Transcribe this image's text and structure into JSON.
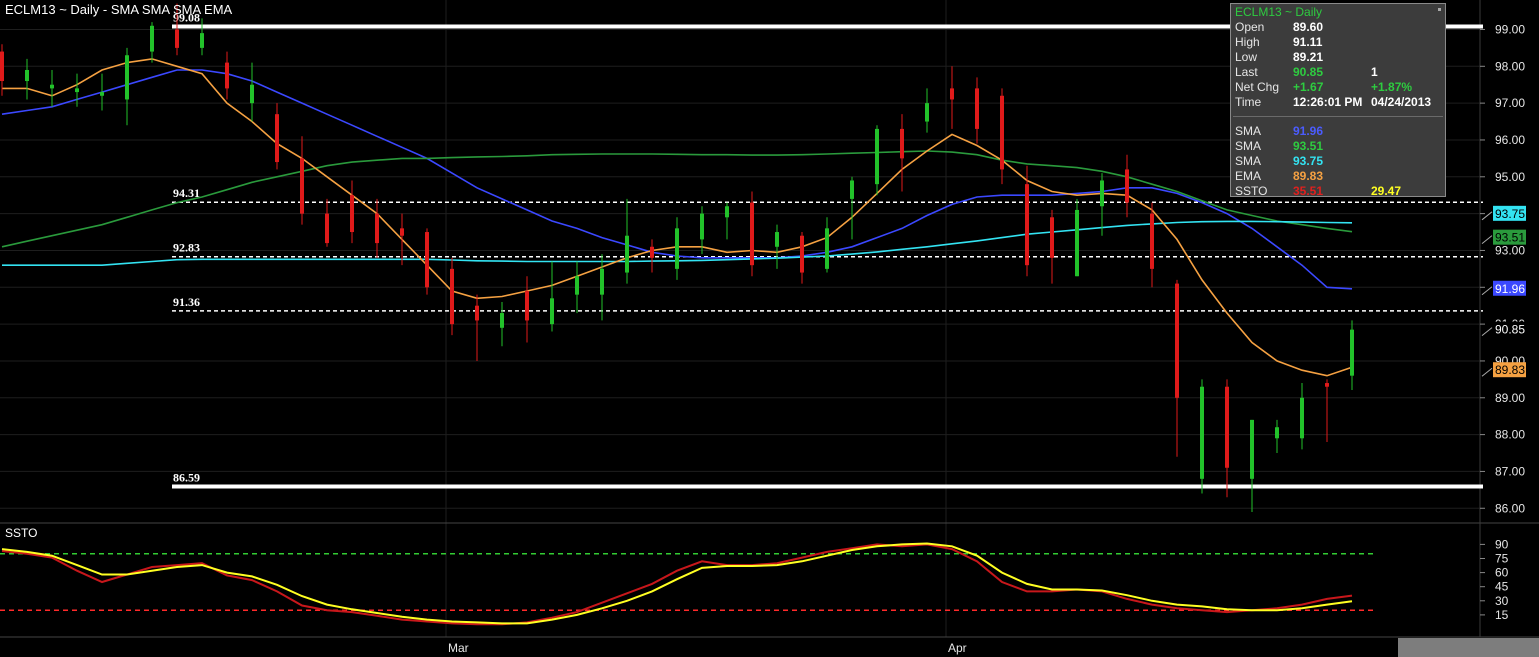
{
  "header": {
    "title": "ECLM13 ~ Daily  -  SMA SMA SMA EMA"
  },
  "chart_data": {
    "type": "candlestick",
    "symbol": "ECLM13 ~ Daily",
    "y_price_range": [
      85.6,
      99.8
    ],
    "price_ticks": [
      "99.00",
      "98.00",
      "97.00",
      "96.00",
      "95.00",
      "94.00",
      "93.00",
      "92.00",
      "91.00",
      "90.00",
      "89.00",
      "88.00",
      "87.00",
      "86.00"
    ],
    "month_labels": [
      {
        "label": "Mar",
        "index": 18
      },
      {
        "label": "Apr",
        "index": 38
      }
    ],
    "candles": [
      [
        98.4,
        98.6,
        97.2,
        97.6
      ],
      [
        97.6,
        98.2,
        97.1,
        97.9
      ],
      [
        97.4,
        97.9,
        96.9,
        97.5
      ],
      [
        97.3,
        97.8,
        96.9,
        97.4
      ],
      [
        97.2,
        97.8,
        96.8,
        97.3
      ],
      [
        97.1,
        98.5,
        96.4,
        98.3
      ],
      [
        98.4,
        99.2,
        98.1,
        99.1
      ],
      [
        99.0,
        99.7,
        98.3,
        98.5
      ],
      [
        98.5,
        99.3,
        98.3,
        98.9
      ],
      [
        98.1,
        98.4,
        97.1,
        97.4
      ],
      [
        97.0,
        98.1,
        96.5,
        97.5
      ],
      [
        96.7,
        97.0,
        95.2,
        95.4
      ],
      [
        95.5,
        96.1,
        93.7,
        94.0
      ],
      [
        94.0,
        94.4,
        93.1,
        93.2
      ],
      [
        94.5,
        94.9,
        93.2,
        93.5
      ],
      [
        94.0,
        94.4,
        92.8,
        93.2
      ],
      [
        93.6,
        94.0,
        92.6,
        93.4
      ],
      [
        93.5,
        93.6,
        91.8,
        92.0
      ],
      [
        92.5,
        92.8,
        90.7,
        91.0
      ],
      [
        91.5,
        91.8,
        90.0,
        91.1
      ],
      [
        90.9,
        91.6,
        90.4,
        91.3
      ],
      [
        91.9,
        92.3,
        90.5,
        91.1
      ],
      [
        91.0,
        92.7,
        90.8,
        91.7
      ],
      [
        91.8,
        92.7,
        91.3,
        92.3
      ],
      [
        91.8,
        92.9,
        91.1,
        92.5
      ],
      [
        92.4,
        94.4,
        92.1,
        93.4
      ],
      [
        93.1,
        93.3,
        92.4,
        92.8
      ],
      [
        92.5,
        93.9,
        92.2,
        93.6
      ],
      [
        93.3,
        94.2,
        92.9,
        94.0
      ],
      [
        93.9,
        94.3,
        93.3,
        94.2
      ],
      [
        94.3,
        94.6,
        92.3,
        92.6
      ],
      [
        93.1,
        93.7,
        92.5,
        93.5
      ],
      [
        93.4,
        93.5,
        92.1,
        92.4
      ],
      [
        92.5,
        93.9,
        92.4,
        93.6
      ],
      [
        94.4,
        95.0,
        93.3,
        94.9
      ],
      [
        94.8,
        96.4,
        94.5,
        96.3
      ],
      [
        96.3,
        96.7,
        94.6,
        95.5
      ],
      [
        96.5,
        97.4,
        96.2,
        97.0
      ],
      [
        97.4,
        98.0,
        96.3,
        97.1
      ],
      [
        97.4,
        97.7,
        95.9,
        96.3
      ],
      [
        97.2,
        97.4,
        94.8,
        95.2
      ],
      [
        94.8,
        95.3,
        92.3,
        92.6
      ],
      [
        93.9,
        94.1,
        92.1,
        92.8
      ],
      [
        92.3,
        94.4,
        92.3,
        94.1
      ],
      [
        94.2,
        95.1,
        93.4,
        94.9
      ],
      [
        95.2,
        95.6,
        93.9,
        94.3
      ],
      [
        94.0,
        94.3,
        92.0,
        92.5
      ],
      [
        92.1,
        92.2,
        87.4,
        89.0
      ],
      [
        86.8,
        89.5,
        86.4,
        89.3
      ],
      [
        89.3,
        89.5,
        86.3,
        87.1
      ],
      [
        86.8,
        88.4,
        85.9,
        88.4
      ],
      [
        87.9,
        88.4,
        87.5,
        88.2
      ],
      [
        87.9,
        89.4,
        87.6,
        89.0
      ],
      [
        89.4,
        89.5,
        87.8,
        89.3
      ],
      [
        89.6,
        91.1,
        89.21,
        90.85
      ]
    ],
    "series": [
      {
        "name": "SMA",
        "color": "#3b48ff",
        "values": [
          96.7,
          96.8,
          96.9,
          97.1,
          97.3,
          97.5,
          97.7,
          97.9,
          97.9,
          97.8,
          97.6,
          97.3,
          97.0,
          96.7,
          96.4,
          96.1,
          95.8,
          95.5,
          95.1,
          94.7,
          94.4,
          94.1,
          93.8,
          93.6,
          93.35,
          93.15,
          92.95,
          92.85,
          92.8,
          92.8,
          92.8,
          92.8,
          92.85,
          92.95,
          93.1,
          93.35,
          93.6,
          93.95,
          94.25,
          94.45,
          94.5,
          94.5,
          94.5,
          94.55,
          94.6,
          94.7,
          94.7,
          94.55,
          94.3,
          94.0,
          93.6,
          93.1,
          92.6,
          92.0,
          91.96
        ]
      },
      {
        "name": "SMA",
        "color": "#2a9a3c",
        "values": [
          93.1,
          93.25,
          93.4,
          93.55,
          93.7,
          93.9,
          94.1,
          94.3,
          94.45,
          94.65,
          94.85,
          95.0,
          95.15,
          95.3,
          95.4,
          95.45,
          95.5,
          95.5,
          95.52,
          95.54,
          95.55,
          95.57,
          95.6,
          95.61,
          95.62,
          95.62,
          95.62,
          95.61,
          95.6,
          95.6,
          95.59,
          95.59,
          95.6,
          95.62,
          95.64,
          95.66,
          95.68,
          95.7,
          95.67,
          95.6,
          95.45,
          95.35,
          95.3,
          95.25,
          95.15,
          95.0,
          94.8,
          94.6,
          94.35,
          94.1,
          93.95,
          93.8,
          93.7,
          93.6,
          93.51
        ]
      },
      {
        "name": "SMA",
        "color": "#33e3f2",
        "values": [
          92.6,
          92.6,
          92.6,
          92.6,
          92.6,
          92.65,
          92.7,
          92.75,
          92.76,
          92.76,
          92.76,
          92.76,
          92.76,
          92.76,
          92.76,
          92.76,
          92.76,
          92.76,
          92.74,
          92.72,
          92.71,
          92.7,
          92.7,
          92.7,
          92.7,
          92.7,
          92.71,
          92.72,
          92.73,
          92.75,
          92.77,
          92.79,
          92.82,
          92.85,
          92.9,
          92.96,
          93.03,
          93.1,
          93.18,
          93.26,
          93.35,
          93.44,
          93.5,
          93.56,
          93.62,
          93.68,
          93.72,
          93.76,
          93.78,
          93.79,
          93.79,
          93.78,
          93.77,
          93.76,
          93.75
        ]
      },
      {
        "name": "EMA",
        "color": "#f5a142",
        "values": [
          97.4,
          97.4,
          97.2,
          97.5,
          97.9,
          98.1,
          98.2,
          98.0,
          97.8,
          97.0,
          96.5,
          95.9,
          95.5,
          95.0,
          94.5,
          94.0,
          93.3,
          92.6,
          91.9,
          91.7,
          91.75,
          91.9,
          92.05,
          92.3,
          92.55,
          92.8,
          93.0,
          93.1,
          93.1,
          92.95,
          93.0,
          92.95,
          93.1,
          93.35,
          93.9,
          94.55,
          95.2,
          95.7,
          96.15,
          95.85,
          95.45,
          94.9,
          94.6,
          94.5,
          94.55,
          94.5,
          94.1,
          93.3,
          92.2,
          91.3,
          90.5,
          90.0,
          89.75,
          89.6,
          89.83
        ]
      }
    ],
    "horizontal_lines": [
      {
        "value": 99.08,
        "label": "99.08",
        "style": "solid"
      },
      {
        "value": 94.31,
        "label": "94.31",
        "style": "dashed"
      },
      {
        "value": 92.83,
        "label": "92.83",
        "style": "dashed"
      },
      {
        "value": 91.36,
        "label": "91.36",
        "style": "dashed"
      },
      {
        "value": 86.59,
        "label": "86.59",
        "style": "solid"
      }
    ],
    "right_markers": [
      {
        "value": 93.75,
        "label": "93.75",
        "bg": "#33e3f2",
        "fg": "#000000"
      },
      {
        "value": 93.51,
        "label": "93.51",
        "bg": "#2a9a3c",
        "fg": "#000000"
      },
      {
        "value": 91.96,
        "label": "91.96",
        "bg": "#3b48ff",
        "fg": "#ffffff"
      },
      {
        "value": 90.85,
        "label": "90.85",
        "bg": "#000000",
        "fg": "#ffffff"
      },
      {
        "value": 89.83,
        "label": "89.83",
        "bg": "#f5a142",
        "fg": "#000000"
      }
    ],
    "ssto": {
      "label": "SSTO",
      "ylim": [
        0,
        100
      ],
      "ticks": [
        "90",
        "75",
        "60",
        "45",
        "30",
        "15"
      ],
      "levels": [
        {
          "value": 80,
          "color": "#33cc33"
        },
        {
          "value": 20,
          "color": "#ff2a2a"
        }
      ],
      "series": [
        {
          "name": "SSTO",
          "color": "#c8171b",
          "values": [
            83,
            80,
            76,
            62,
            50,
            58,
            66,
            68,
            70,
            57,
            52,
            40,
            25,
            20,
            18,
            14,
            10,
            8,
            6,
            5,
            5,
            7,
            12,
            18,
            28,
            38,
            48,
            62,
            72,
            68,
            68,
            70,
            76,
            82,
            86,
            90,
            88,
            90,
            85,
            72,
            50,
            40,
            40,
            42,
            40,
            32,
            26,
            22,
            20,
            18,
            20,
            22,
            26,
            32,
            35.51
          ]
        },
        {
          "name": "SSTO",
          "color": "#ffff22",
          "values": [
            85,
            82,
            78,
            68,
            58,
            58,
            62,
            66,
            68,
            60,
            56,
            47,
            35,
            26,
            21,
            17,
            13,
            10,
            8,
            7,
            6,
            6,
            10,
            15,
            22,
            30,
            40,
            53,
            65,
            67,
            67,
            68,
            72,
            78,
            84,
            88,
            90,
            91,
            88,
            78,
            60,
            48,
            42,
            42,
            41,
            36,
            30,
            26,
            24,
            21,
            20,
            20,
            22,
            26,
            29.47
          ]
        }
      ]
    }
  },
  "info_box": {
    "title": "ECLM13 ~ Daily",
    "rows": [
      {
        "label": "Open",
        "value": "89.60",
        "value_color": "#ffffff"
      },
      {
        "label": "High",
        "value": "91.11",
        "value_color": "#ffffff"
      },
      {
        "label": "Low",
        "value": "89.21",
        "value_color": "#ffffff"
      },
      {
        "label": "Last",
        "value": "90.85",
        "value_color": "#2ecc40",
        "value2": "1",
        "value2_color": "#ffffff"
      },
      {
        "label": "Net Chg",
        "value": "+1.67",
        "value_color": "#2ecc40",
        "value2": "+1.87%",
        "value2_color": "#2ecc40"
      },
      {
        "label": "Time",
        "value": "12:26:01 PM",
        "value_color": "#ffffff",
        "value2": "04/24/2013",
        "value2_color": "#ffffff"
      }
    ],
    "studies": [
      {
        "label": "SMA",
        "value": "91.96",
        "value_color": "#4b5cff"
      },
      {
        "label": "SMA",
        "value": "93.51",
        "value_color": "#2ecc40"
      },
      {
        "label": "SMA",
        "value": "93.75",
        "value_color": "#33e3f2"
      },
      {
        "label": "EMA",
        "value": "89.83",
        "value_color": "#f5a142"
      },
      {
        "label": "SSTO",
        "value": "35.51",
        "value_color": "#e0201e",
        "value2": "29.47",
        "value2_color": "#ffff22"
      }
    ]
  }
}
